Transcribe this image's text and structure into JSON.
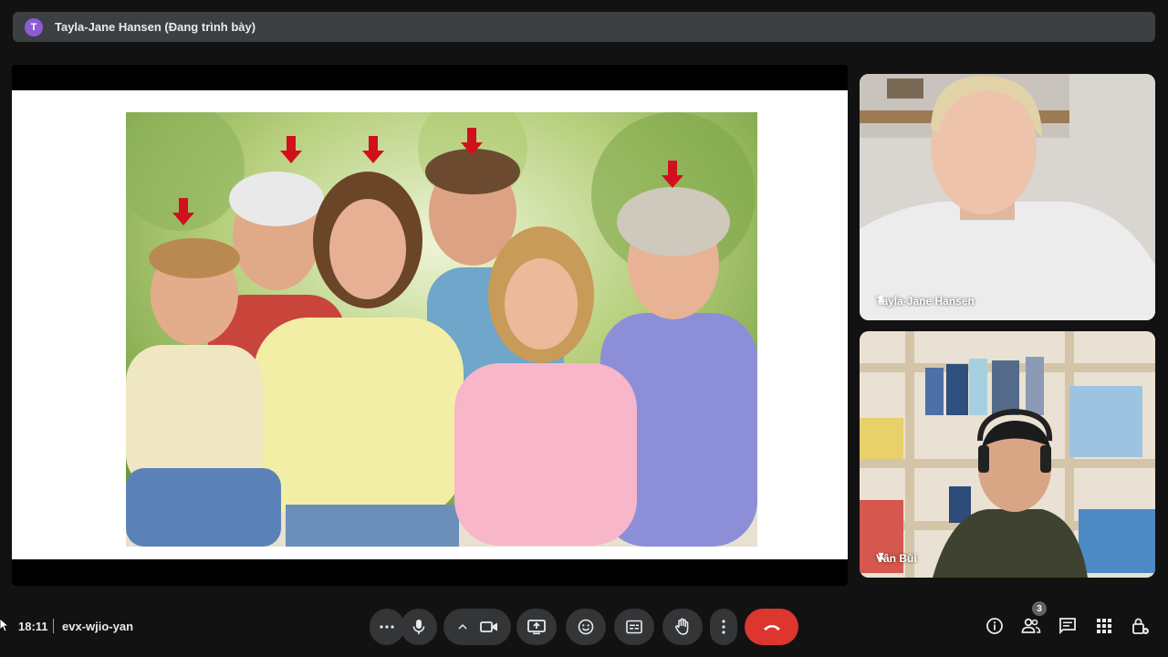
{
  "presenter_bar": {
    "avatar_initial": "T",
    "label": "Tayla-Jane Hansen (Đang trình bày)"
  },
  "participants": [
    {
      "name": "Tayla-Jane Hansen",
      "pinned": true
    },
    {
      "name": "Vân Bùi",
      "pinned": true
    }
  ],
  "footer": {
    "time": "18:11",
    "meeting_code": "evx-wjio-yan",
    "people_count": "3"
  },
  "controls": [
    {
      "icon": "more-options-icon"
    },
    {
      "icon": "microphone-icon"
    },
    {
      "icon": "chevron-up-icon"
    },
    {
      "icon": "camera-icon"
    },
    {
      "icon": "present-screen-icon"
    },
    {
      "icon": "emoji-icon"
    },
    {
      "icon": "captions-icon"
    },
    {
      "icon": "raise-hand-icon"
    },
    {
      "icon": "more-vert-icon"
    },
    {
      "icon": "end-call-icon"
    }
  ],
  "right_controls": [
    {
      "icon": "info-icon"
    },
    {
      "icon": "people-icon"
    },
    {
      "icon": "chat-icon"
    },
    {
      "icon": "activities-icon"
    },
    {
      "icon": "host-controls-icon"
    }
  ],
  "colors": {
    "background": "#121212",
    "control_button": "#333537",
    "end_call": "#dc362e",
    "presenter_avatar": "#8e5bd6"
  }
}
